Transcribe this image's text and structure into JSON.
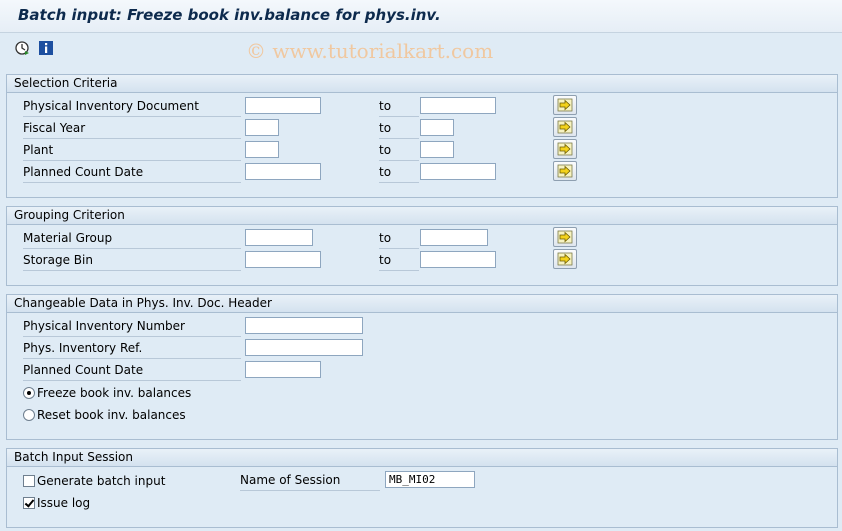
{
  "window": {
    "title": "Batch input: Freeze book inv.balance for phys.inv."
  },
  "toolbar": {
    "icons": [
      "execute-icon",
      "info-icon"
    ]
  },
  "watermark": "© www.tutorialkart.com",
  "selection": {
    "title": "Selection Criteria",
    "rows": [
      {
        "label": "Physical Inventory Document",
        "from": "",
        "to_label": "to",
        "to": ""
      },
      {
        "label": "Fiscal Year",
        "from": "",
        "to_label": "to",
        "to": ""
      },
      {
        "label": "Plant",
        "from": "",
        "to_label": "to",
        "to": ""
      },
      {
        "label": "Planned Count Date",
        "from": "",
        "to_label": "to",
        "to": ""
      }
    ]
  },
  "grouping": {
    "title": "Grouping Criterion",
    "rows": [
      {
        "label": "Material Group",
        "from": "",
        "to_label": "to",
        "to": ""
      },
      {
        "label": "Storage Bin",
        "from": "",
        "to_label": "to",
        "to": ""
      }
    ]
  },
  "changeable": {
    "title": "Changeable Data in Phys. Inv. Doc. Header",
    "fields": [
      {
        "label": "Physical Inventory Number",
        "value": ""
      },
      {
        "label": "Phys. Inventory Ref.",
        "value": ""
      },
      {
        "label": "Planned Count Date",
        "value": ""
      }
    ],
    "radios": [
      {
        "label": "Freeze book inv. balances",
        "selected": true
      },
      {
        "label": "Reset book inv. balances",
        "selected": false
      }
    ]
  },
  "batch": {
    "title": "Batch Input Session",
    "generate_label": "Generate batch input",
    "generate_checked": false,
    "session_label": "Name of Session",
    "session_value": "MB_MI02",
    "issue_log_label": "Issue log",
    "issue_log_checked": true
  },
  "colors": {
    "title_text": "#0d2a4d",
    "background": "#dfebf5",
    "group_border": "#a9bdd1",
    "arrow_yellow": "#f3d21b"
  }
}
